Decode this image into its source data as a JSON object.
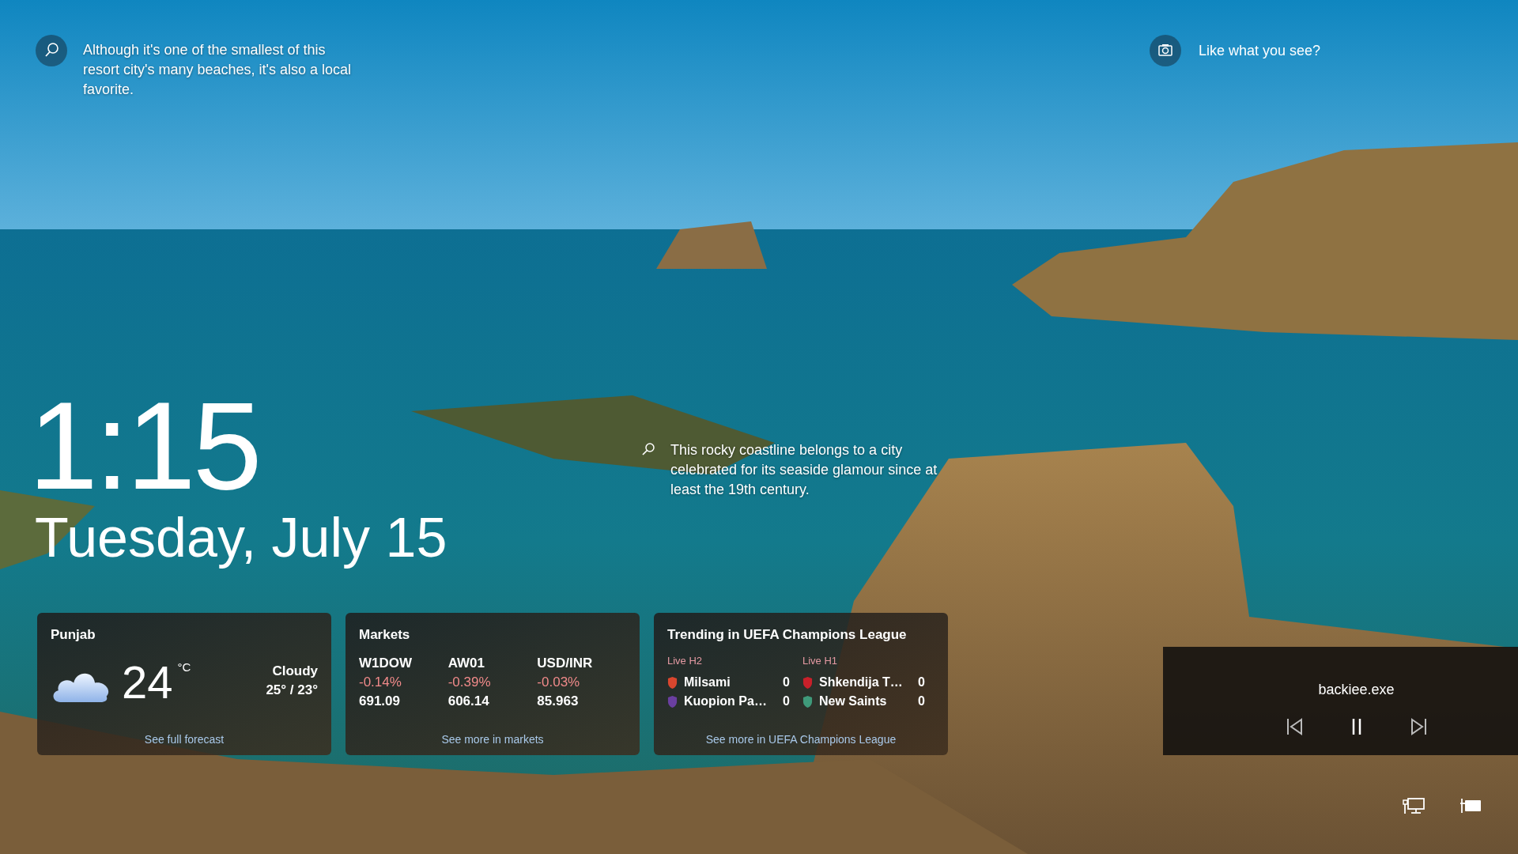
{
  "spotlight": {
    "caption": "Although it's one of the smallest of this resort city's many beaches, it's also a local favorite.",
    "feedback": "Like what you see?"
  },
  "hotspots": [
    {
      "text": "This rocky coastline belongs to a city celebrated for its seaside glamour since at least the 19th century."
    }
  ],
  "clock": {
    "time": "1:15",
    "date": "Tuesday, July 15"
  },
  "cards": [
    {
      "kind": "weather",
      "title": "Punjab",
      "temperature": "24",
      "unit": "°C",
      "condition": "Cloudy",
      "range": "25° / 23°",
      "link": "See full forecast"
    },
    {
      "kind": "markets",
      "title": "Markets",
      "quotes": [
        {
          "symbol": "W1DOW",
          "change": "-0.14%",
          "price": "691.09"
        },
        {
          "symbol": "AW01",
          "change": "-0.39%",
          "price": "606.14"
        },
        {
          "symbol": "USD/INR",
          "change": "-0.03%",
          "price": "85.963"
        }
      ],
      "link": "See more in markets"
    },
    {
      "kind": "sports",
      "title": "Trending in UEFA Champions League",
      "matches": [
        {
          "status": "Live H2",
          "teams": [
            {
              "name": "Milsami",
              "score": "0",
              "color": "#d9462e"
            },
            {
              "name": "Kuopion Pa…",
              "score": "0",
              "color": "#6a3fa0"
            }
          ]
        },
        {
          "status": "Live H1",
          "teams": [
            {
              "name": "Shkendija T…",
              "score": "0",
              "color": "#c8202a"
            },
            {
              "name": "New Saints",
              "score": "0",
              "color": "#3f9a7a"
            }
          ]
        }
      ],
      "link": "See more in UEFA Champions League"
    }
  ],
  "media": {
    "title": "backiee.exe",
    "playing": true
  }
}
